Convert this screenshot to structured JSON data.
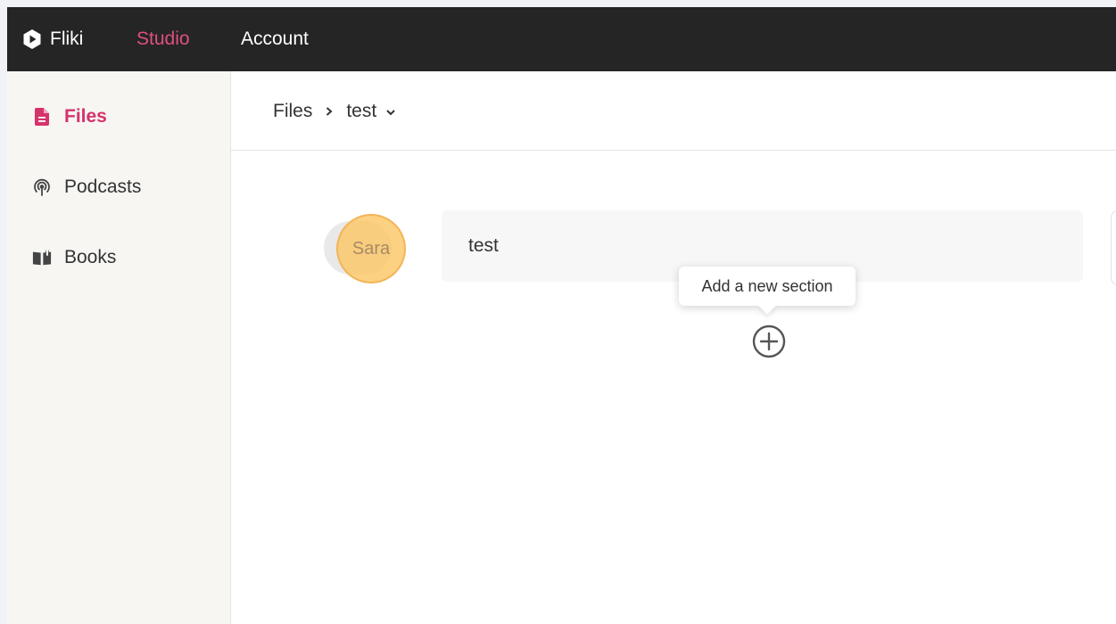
{
  "topbar": {
    "brand": "Fliki",
    "nav": {
      "studio": "Studio",
      "account": "Account"
    },
    "accent_color": "#e0507f",
    "background": "#252525"
  },
  "sidebar": {
    "items": [
      {
        "label": "Files",
        "icon": "file-icon",
        "active": true
      },
      {
        "label": "Podcasts",
        "icon": "podcast-icon",
        "active": false
      },
      {
        "label": "Books",
        "icon": "book-icon",
        "active": false
      }
    ],
    "active_color": "#d5336c"
  },
  "breadcrumb": {
    "root": "Files",
    "separator": "›",
    "current": "test"
  },
  "section": {
    "voice": "Sara",
    "text": "test"
  },
  "tooltip": {
    "text": "Add a new section"
  }
}
